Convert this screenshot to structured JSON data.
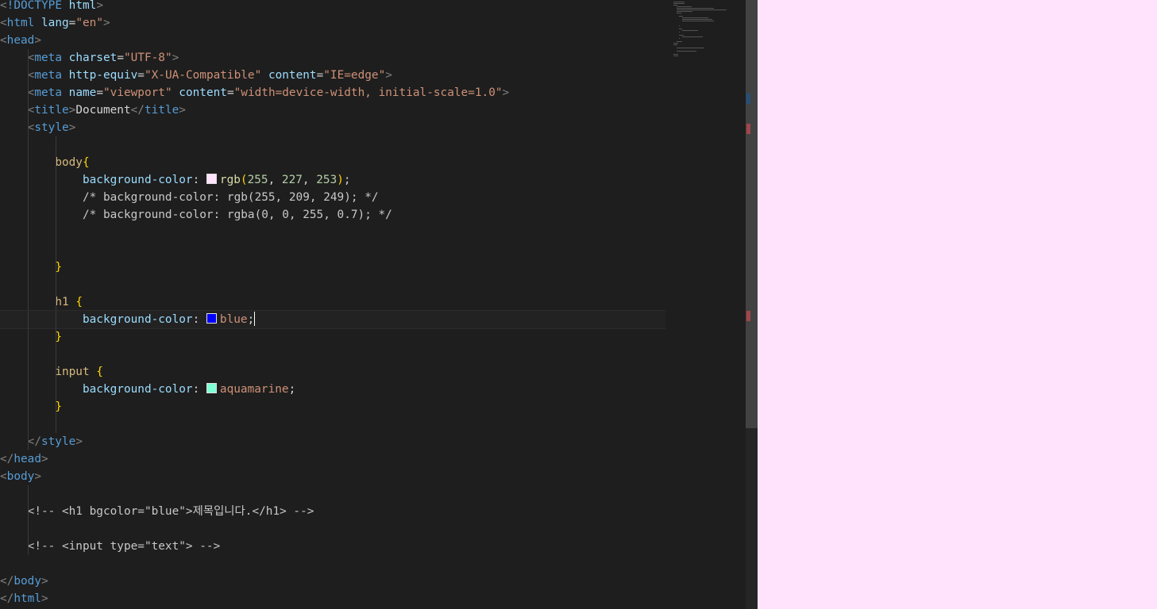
{
  "editor": {
    "lines": [
      {
        "d": 0,
        "spans": [
          {
            "c": "punct",
            "t": "<"
          },
          {
            "c": "tag",
            "t": "!DOCTYPE "
          },
          {
            "c": "attr",
            "t": "html"
          },
          {
            "c": "punct",
            "t": ">"
          }
        ]
      },
      {
        "d": 0,
        "spans": [
          {
            "c": "punct",
            "t": "<"
          },
          {
            "c": "tag",
            "t": "html "
          },
          {
            "c": "attr",
            "t": "lang"
          },
          {
            "c": "text",
            "t": "="
          },
          {
            "c": "str",
            "t": "\"en\""
          },
          {
            "c": "punct",
            "t": ">"
          }
        ]
      },
      {
        "d": 0,
        "spans": [
          {
            "c": "punct",
            "t": "<"
          },
          {
            "c": "tag",
            "t": "head"
          },
          {
            "c": "punct",
            "t": ">"
          }
        ]
      },
      {
        "d": 1,
        "spans": [
          {
            "c": "text",
            "t": "    "
          },
          {
            "c": "punct",
            "t": "<"
          },
          {
            "c": "tag",
            "t": "meta "
          },
          {
            "c": "attr",
            "t": "charset"
          },
          {
            "c": "text",
            "t": "="
          },
          {
            "c": "str",
            "t": "\"UTF-8\""
          },
          {
            "c": "punct",
            "t": ">"
          }
        ]
      },
      {
        "d": 1,
        "spans": [
          {
            "c": "text",
            "t": "    "
          },
          {
            "c": "punct",
            "t": "<"
          },
          {
            "c": "tag",
            "t": "meta "
          },
          {
            "c": "attr",
            "t": "http-equiv"
          },
          {
            "c": "text",
            "t": "="
          },
          {
            "c": "str",
            "t": "\"X-UA-Compatible\""
          },
          {
            "c": "text",
            "t": " "
          },
          {
            "c": "attr",
            "t": "content"
          },
          {
            "c": "text",
            "t": "="
          },
          {
            "c": "str",
            "t": "\"IE=edge\""
          },
          {
            "c": "punct",
            "t": ">"
          }
        ]
      },
      {
        "d": 1,
        "spans": [
          {
            "c": "text",
            "t": "    "
          },
          {
            "c": "punct",
            "t": "<"
          },
          {
            "c": "tag",
            "t": "meta "
          },
          {
            "c": "attr",
            "t": "name"
          },
          {
            "c": "text",
            "t": "="
          },
          {
            "c": "str",
            "t": "\"viewport\""
          },
          {
            "c": "text",
            "t": " "
          },
          {
            "c": "attr",
            "t": "content"
          },
          {
            "c": "text",
            "t": "="
          },
          {
            "c": "str",
            "t": "\"width=device-width, initial-scale=1.0\""
          },
          {
            "c": "punct",
            "t": ">"
          }
        ]
      },
      {
        "d": 1,
        "spans": [
          {
            "c": "text",
            "t": "    "
          },
          {
            "c": "punct",
            "t": "<"
          },
          {
            "c": "tag",
            "t": "title"
          },
          {
            "c": "punct",
            "t": ">"
          },
          {
            "c": "text",
            "t": "Document"
          },
          {
            "c": "punct",
            "t": "</"
          },
          {
            "c": "tag",
            "t": "title"
          },
          {
            "c": "punct",
            "t": ">"
          }
        ]
      },
      {
        "d": 1,
        "spans": [
          {
            "c": "text",
            "t": "    "
          },
          {
            "c": "punct",
            "t": "<"
          },
          {
            "c": "tag",
            "t": "style"
          },
          {
            "c": "punct",
            "t": ">"
          }
        ]
      },
      {
        "d": 2,
        "spans": []
      },
      {
        "d": 2,
        "spans": [
          {
            "c": "text",
            "t": "        "
          },
          {
            "c": "sel",
            "t": "body"
          },
          {
            "c": "brace",
            "t": "{"
          }
        ]
      },
      {
        "d": 3,
        "spans": [
          {
            "c": "text",
            "t": "            "
          },
          {
            "c": "prop",
            "t": "background-color"
          },
          {
            "c": "text",
            "t": ": "
          },
          {
            "c": "swatch",
            "t": "#ffe3fd"
          },
          {
            "c": "fn",
            "t": "rgb"
          },
          {
            "c": "brace",
            "t": "("
          },
          {
            "c": "num",
            "t": "255"
          },
          {
            "c": "text",
            "t": ", "
          },
          {
            "c": "num",
            "t": "227"
          },
          {
            "c": "text",
            "t": ", "
          },
          {
            "c": "num",
            "t": "253"
          },
          {
            "c": "brace",
            "t": ")"
          },
          {
            "c": "text",
            "t": ";"
          }
        ]
      },
      {
        "d": 3,
        "spans": [
          {
            "c": "text",
            "t": "            "
          },
          {
            "c": "comment",
            "t": "/* background-color: rgb(255, 209, 249); */"
          }
        ]
      },
      {
        "d": 3,
        "spans": [
          {
            "c": "text",
            "t": "            "
          },
          {
            "c": "comment",
            "t": "/* background-color: rgba(0, 0, 255, 0.7); */"
          }
        ]
      },
      {
        "d": 3,
        "spans": []
      },
      {
        "d": 3,
        "spans": []
      },
      {
        "d": 2,
        "spans": [
          {
            "c": "text",
            "t": "        "
          },
          {
            "c": "brace",
            "t": "}"
          }
        ]
      },
      {
        "d": 2,
        "spans": []
      },
      {
        "d": 2,
        "spans": [
          {
            "c": "text",
            "t": "        "
          },
          {
            "c": "sel",
            "t": "h1 "
          },
          {
            "c": "brace",
            "t": "{"
          }
        ]
      },
      {
        "d": 3,
        "cur": true,
        "spans": [
          {
            "c": "text",
            "t": "            "
          },
          {
            "c": "prop",
            "t": "background-color"
          },
          {
            "c": "text",
            "t": ": "
          },
          {
            "c": "swatch",
            "t": "#0000ff"
          },
          {
            "c": "val",
            "t": "blue"
          },
          {
            "c": "text",
            "t": ";"
          },
          {
            "c": "cursor",
            "t": ""
          }
        ]
      },
      {
        "d": 2,
        "spans": [
          {
            "c": "text",
            "t": "        "
          },
          {
            "c": "brace",
            "t": "}"
          }
        ]
      },
      {
        "d": 2,
        "spans": []
      },
      {
        "d": 2,
        "spans": [
          {
            "c": "text",
            "t": "        "
          },
          {
            "c": "sel",
            "t": "input "
          },
          {
            "c": "brace",
            "t": "{"
          }
        ]
      },
      {
        "d": 3,
        "spans": [
          {
            "c": "text",
            "t": "            "
          },
          {
            "c": "prop",
            "t": "background-color"
          },
          {
            "c": "text",
            "t": ": "
          },
          {
            "c": "swatch",
            "t": "#7fffd4"
          },
          {
            "c": "val",
            "t": "aquamarine"
          },
          {
            "c": "text",
            "t": ";"
          }
        ]
      },
      {
        "d": 2,
        "spans": [
          {
            "c": "text",
            "t": "        "
          },
          {
            "c": "brace",
            "t": "}"
          }
        ]
      },
      {
        "d": 2,
        "spans": []
      },
      {
        "d": 1,
        "spans": [
          {
            "c": "text",
            "t": "    "
          },
          {
            "c": "punct",
            "t": "</"
          },
          {
            "c": "tag",
            "t": "style"
          },
          {
            "c": "punct",
            "t": ">"
          }
        ]
      },
      {
        "d": 0,
        "spans": [
          {
            "c": "punct",
            "t": "</"
          },
          {
            "c": "tag",
            "t": "head"
          },
          {
            "c": "punct",
            "t": ">"
          }
        ]
      },
      {
        "d": 0,
        "spans": [
          {
            "c": "punct",
            "t": "<"
          },
          {
            "c": "tag",
            "t": "body"
          },
          {
            "c": "punct",
            "t": ">"
          }
        ]
      },
      {
        "d": 1,
        "spans": []
      },
      {
        "d": 1,
        "spans": [
          {
            "c": "text",
            "t": "    "
          },
          {
            "c": "comment",
            "t": "<!-- <h1 bgcolor=\"blue\">제목입니다.</h1> -->"
          }
        ]
      },
      {
        "d": 1,
        "spans": []
      },
      {
        "d": 1,
        "spans": [
          {
            "c": "text",
            "t": "    "
          },
          {
            "c": "comment",
            "t": "<!-- <input type=\"text\"> -->"
          }
        ]
      },
      {
        "d": 0,
        "spans": []
      },
      {
        "d": 0,
        "spans": [
          {
            "c": "punct",
            "t": "</"
          },
          {
            "c": "tag",
            "t": "body"
          },
          {
            "c": "punct",
            "t": ">"
          }
        ]
      },
      {
        "d": 0,
        "spans": [
          {
            "c": "punct",
            "t": "</"
          },
          {
            "c": "tag",
            "t": "html"
          },
          {
            "c": "punct",
            "t": ">"
          }
        ]
      }
    ]
  },
  "preview": {
    "background": "#ffe3fd"
  },
  "colors": {
    "editor_bg": "#1e1e1e",
    "scroll_marker_blue": "#264f78",
    "scroll_marker_red": "#a1464b"
  }
}
